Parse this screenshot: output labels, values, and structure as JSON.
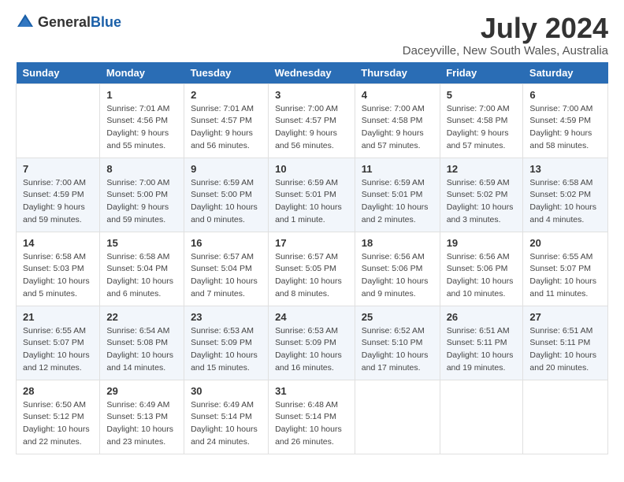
{
  "header": {
    "logo_general": "General",
    "logo_blue": "Blue",
    "title": "July 2024",
    "subtitle": "Daceyville, New South Wales, Australia"
  },
  "columns": [
    "Sunday",
    "Monday",
    "Tuesday",
    "Wednesday",
    "Thursday",
    "Friday",
    "Saturday"
  ],
  "weeks": [
    {
      "days": [
        {
          "num": "",
          "lines": []
        },
        {
          "num": "1",
          "lines": [
            "Sunrise: 7:01 AM",
            "Sunset: 4:56 PM",
            "Daylight: 9 hours",
            "and 55 minutes."
          ]
        },
        {
          "num": "2",
          "lines": [
            "Sunrise: 7:01 AM",
            "Sunset: 4:57 PM",
            "Daylight: 9 hours",
            "and 56 minutes."
          ]
        },
        {
          "num": "3",
          "lines": [
            "Sunrise: 7:00 AM",
            "Sunset: 4:57 PM",
            "Daylight: 9 hours",
            "and 56 minutes."
          ]
        },
        {
          "num": "4",
          "lines": [
            "Sunrise: 7:00 AM",
            "Sunset: 4:58 PM",
            "Daylight: 9 hours",
            "and 57 minutes."
          ]
        },
        {
          "num": "5",
          "lines": [
            "Sunrise: 7:00 AM",
            "Sunset: 4:58 PM",
            "Daylight: 9 hours",
            "and 57 minutes."
          ]
        },
        {
          "num": "6",
          "lines": [
            "Sunrise: 7:00 AM",
            "Sunset: 4:59 PM",
            "Daylight: 9 hours",
            "and 58 minutes."
          ]
        }
      ]
    },
    {
      "days": [
        {
          "num": "7",
          "lines": [
            "Sunrise: 7:00 AM",
            "Sunset: 4:59 PM",
            "Daylight: 9 hours",
            "and 59 minutes."
          ]
        },
        {
          "num": "8",
          "lines": [
            "Sunrise: 7:00 AM",
            "Sunset: 5:00 PM",
            "Daylight: 9 hours",
            "and 59 minutes."
          ]
        },
        {
          "num": "9",
          "lines": [
            "Sunrise: 6:59 AM",
            "Sunset: 5:00 PM",
            "Daylight: 10 hours",
            "and 0 minutes."
          ]
        },
        {
          "num": "10",
          "lines": [
            "Sunrise: 6:59 AM",
            "Sunset: 5:01 PM",
            "Daylight: 10 hours",
            "and 1 minute."
          ]
        },
        {
          "num": "11",
          "lines": [
            "Sunrise: 6:59 AM",
            "Sunset: 5:01 PM",
            "Daylight: 10 hours",
            "and 2 minutes."
          ]
        },
        {
          "num": "12",
          "lines": [
            "Sunrise: 6:59 AM",
            "Sunset: 5:02 PM",
            "Daylight: 10 hours",
            "and 3 minutes."
          ]
        },
        {
          "num": "13",
          "lines": [
            "Sunrise: 6:58 AM",
            "Sunset: 5:02 PM",
            "Daylight: 10 hours",
            "and 4 minutes."
          ]
        }
      ]
    },
    {
      "days": [
        {
          "num": "14",
          "lines": [
            "Sunrise: 6:58 AM",
            "Sunset: 5:03 PM",
            "Daylight: 10 hours",
            "and 5 minutes."
          ]
        },
        {
          "num": "15",
          "lines": [
            "Sunrise: 6:58 AM",
            "Sunset: 5:04 PM",
            "Daylight: 10 hours",
            "and 6 minutes."
          ]
        },
        {
          "num": "16",
          "lines": [
            "Sunrise: 6:57 AM",
            "Sunset: 5:04 PM",
            "Daylight: 10 hours",
            "and 7 minutes."
          ]
        },
        {
          "num": "17",
          "lines": [
            "Sunrise: 6:57 AM",
            "Sunset: 5:05 PM",
            "Daylight: 10 hours",
            "and 8 minutes."
          ]
        },
        {
          "num": "18",
          "lines": [
            "Sunrise: 6:56 AM",
            "Sunset: 5:06 PM",
            "Daylight: 10 hours",
            "and 9 minutes."
          ]
        },
        {
          "num": "19",
          "lines": [
            "Sunrise: 6:56 AM",
            "Sunset: 5:06 PM",
            "Daylight: 10 hours",
            "and 10 minutes."
          ]
        },
        {
          "num": "20",
          "lines": [
            "Sunrise: 6:55 AM",
            "Sunset: 5:07 PM",
            "Daylight: 10 hours",
            "and 11 minutes."
          ]
        }
      ]
    },
    {
      "days": [
        {
          "num": "21",
          "lines": [
            "Sunrise: 6:55 AM",
            "Sunset: 5:07 PM",
            "Daylight: 10 hours",
            "and 12 minutes."
          ]
        },
        {
          "num": "22",
          "lines": [
            "Sunrise: 6:54 AM",
            "Sunset: 5:08 PM",
            "Daylight: 10 hours",
            "and 14 minutes."
          ]
        },
        {
          "num": "23",
          "lines": [
            "Sunrise: 6:53 AM",
            "Sunset: 5:09 PM",
            "Daylight: 10 hours",
            "and 15 minutes."
          ]
        },
        {
          "num": "24",
          "lines": [
            "Sunrise: 6:53 AM",
            "Sunset: 5:09 PM",
            "Daylight: 10 hours",
            "and 16 minutes."
          ]
        },
        {
          "num": "25",
          "lines": [
            "Sunrise: 6:52 AM",
            "Sunset: 5:10 PM",
            "Daylight: 10 hours",
            "and 17 minutes."
          ]
        },
        {
          "num": "26",
          "lines": [
            "Sunrise: 6:51 AM",
            "Sunset: 5:11 PM",
            "Daylight: 10 hours",
            "and 19 minutes."
          ]
        },
        {
          "num": "27",
          "lines": [
            "Sunrise: 6:51 AM",
            "Sunset: 5:11 PM",
            "Daylight: 10 hours",
            "and 20 minutes."
          ]
        }
      ]
    },
    {
      "days": [
        {
          "num": "28",
          "lines": [
            "Sunrise: 6:50 AM",
            "Sunset: 5:12 PM",
            "Daylight: 10 hours",
            "and 22 minutes."
          ]
        },
        {
          "num": "29",
          "lines": [
            "Sunrise: 6:49 AM",
            "Sunset: 5:13 PM",
            "Daylight: 10 hours",
            "and 23 minutes."
          ]
        },
        {
          "num": "30",
          "lines": [
            "Sunrise: 6:49 AM",
            "Sunset: 5:14 PM",
            "Daylight: 10 hours",
            "and 24 minutes."
          ]
        },
        {
          "num": "31",
          "lines": [
            "Sunrise: 6:48 AM",
            "Sunset: 5:14 PM",
            "Daylight: 10 hours",
            "and 26 minutes."
          ]
        },
        {
          "num": "",
          "lines": []
        },
        {
          "num": "",
          "lines": []
        },
        {
          "num": "",
          "lines": []
        }
      ]
    }
  ]
}
